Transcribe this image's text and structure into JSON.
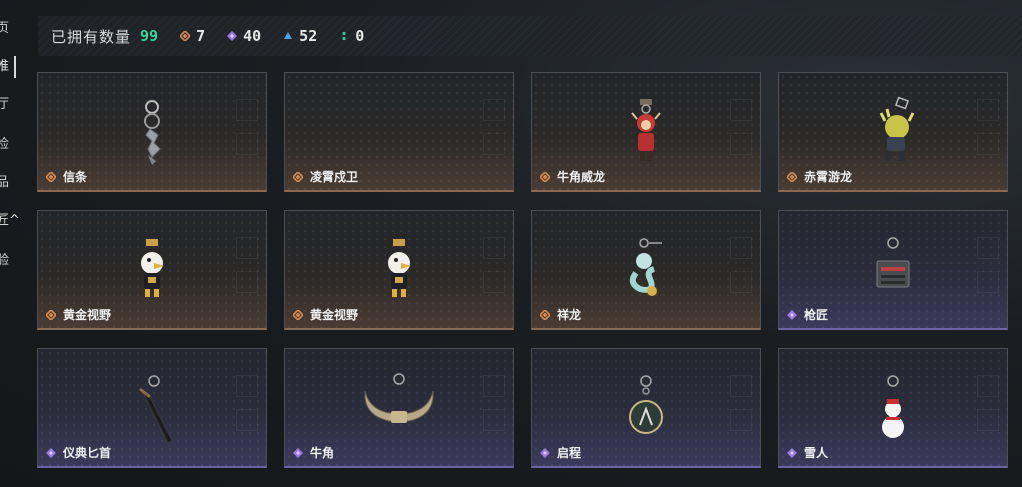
{
  "sidebar": {
    "items": [
      {
        "label": "页"
      },
      {
        "label": "推",
        "active": true
      },
      {
        "label": "厅"
      },
      {
        "label": "检"
      },
      {
        "label": "品"
      },
      {
        "label": "匠^"
      },
      {
        "label": "验"
      }
    ]
  },
  "summary": {
    "owned_label": "已拥有数量",
    "owned_count": "99",
    "stats": [
      {
        "rarity": "orange",
        "count": "7",
        "color": "#d98a4f"
      },
      {
        "rarity": "purple",
        "count": "40",
        "color": "#9a7ae0"
      },
      {
        "rarity": "blue",
        "count": "52",
        "color": "#4aa3e8"
      },
      {
        "rarity": "green",
        "count": "0",
        "color": "#36c79a"
      }
    ]
  },
  "colors": {
    "orange_rarity": "#d98a4f",
    "purple_rarity": "#9a7ae0",
    "accent_green": "#39d39a"
  },
  "items": [
    {
      "name": "信条",
      "rarity": "orange",
      "art": "silver-fish-keychain-icon"
    },
    {
      "name": "凌霄戍卫",
      "rarity": "orange",
      "art": "empty-slot"
    },
    {
      "name": "牛角威龙",
      "rarity": "orange",
      "art": "red-warrior-keychain-icon"
    },
    {
      "name": "赤霄游龙",
      "rarity": "orange",
      "art": "yellow-dragon-keychain-icon"
    },
    {
      "name": "黄金视野",
      "rarity": "orange",
      "art": "eagle-mascot-keychain-icon"
    },
    {
      "name": "黄金视野",
      "rarity": "orange",
      "art": "eagle-mascot-keychain-icon"
    },
    {
      "name": "祥龙",
      "rarity": "orange",
      "art": "jade-dragon-keychain-icon"
    },
    {
      "name": "枪匠",
      "rarity": "purple",
      "art": "gun-case-keychain-icon"
    },
    {
      "name": "仪典匕首",
      "rarity": "purple",
      "art": "dagger-keychain-icon"
    },
    {
      "name": "牛角",
      "rarity": "purple",
      "art": "bull-horns-keychain-icon"
    },
    {
      "name": "启程",
      "rarity": "purple",
      "art": "round-badge-keychain-icon"
    },
    {
      "name": "雪人",
      "rarity": "purple",
      "art": "snowman-keychain-icon"
    }
  ]
}
